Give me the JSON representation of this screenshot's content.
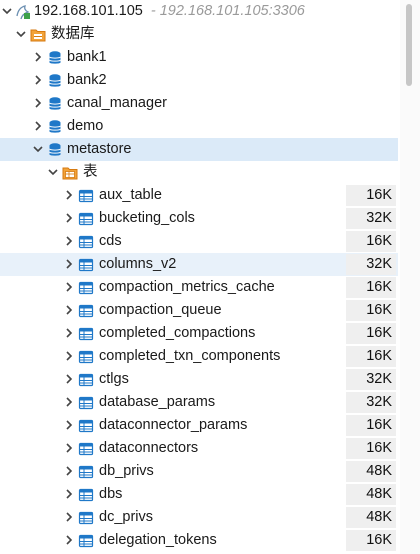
{
  "connection": {
    "name": "192.168.101.105",
    "address": "- 192.168.101.105:3306"
  },
  "databases_node": {
    "label": "数据库"
  },
  "databases": [
    "bank1",
    "bank2",
    "canal_manager",
    "demo"
  ],
  "selected_db": {
    "label": "metastore"
  },
  "tables_node": {
    "label": "表"
  },
  "tables": [
    {
      "name": "aux_table",
      "size": "16K"
    },
    {
      "name": "bucketing_cols",
      "size": "32K"
    },
    {
      "name": "cds",
      "size": "16K"
    },
    {
      "name": "columns_v2",
      "size": "32K"
    },
    {
      "name": "compaction_metrics_cache",
      "size": "16K"
    },
    {
      "name": "compaction_queue",
      "size": "16K"
    },
    {
      "name": "completed_compactions",
      "size": "16K"
    },
    {
      "name": "completed_txn_components",
      "size": "16K"
    },
    {
      "name": "ctlgs",
      "size": "32K"
    },
    {
      "name": "database_params",
      "size": "32K"
    },
    {
      "name": "dataconnector_params",
      "size": "16K"
    },
    {
      "name": "dataconnectors",
      "size": "16K"
    },
    {
      "name": "db_privs",
      "size": "48K"
    },
    {
      "name": "dbs",
      "size": "48K"
    },
    {
      "name": "dc_privs",
      "size": "48K"
    },
    {
      "name": "delegation_tokens",
      "size": "16K"
    }
  ],
  "icons": {
    "connection": "mysql-connection-icon",
    "folder": "database-folder-icon",
    "database": "database-icon",
    "tables_folder": "tables-folder-icon",
    "table": "table-icon"
  },
  "colors": {
    "accent": "#1f78c8",
    "folder": "#e8891c",
    "selection": "#dbeaf8"
  }
}
